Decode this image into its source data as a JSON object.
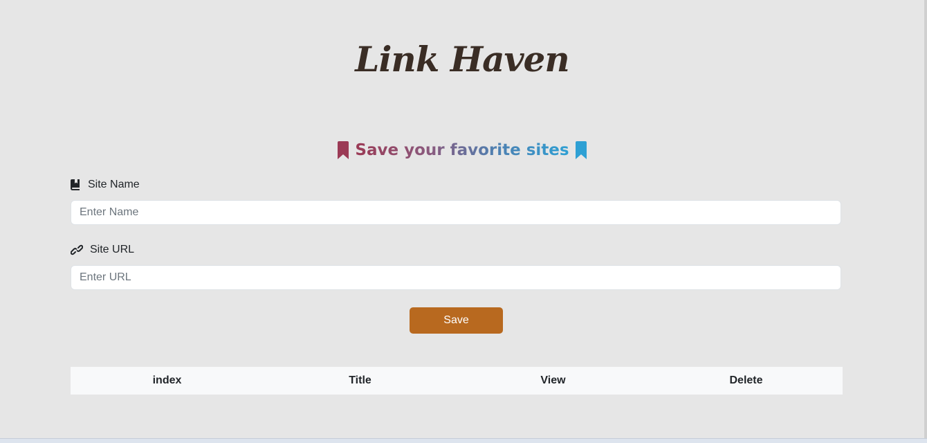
{
  "header": {
    "title": "Link Haven"
  },
  "tagline": {
    "text": "Save your favorite sites",
    "left_icon": "bookmark-icon",
    "right_icon": "bookmark-icon",
    "left_icon_color": "#9b3a55",
    "right_icon_color": "#2ea0d4"
  },
  "form": {
    "site_name": {
      "label": "Site Name",
      "icon": "book-bookmark-icon",
      "placeholder": "Enter Name",
      "value": ""
    },
    "site_url": {
      "label": "Site URL",
      "icon": "link-icon",
      "placeholder": "Enter URL",
      "value": ""
    },
    "save_label": "Save"
  },
  "table": {
    "columns": [
      "index",
      "Title",
      "View",
      "Delete"
    ],
    "rows": []
  },
  "colors": {
    "background": "#e6e6e6",
    "accent": "#b8691f",
    "title": "#3a2d25"
  }
}
